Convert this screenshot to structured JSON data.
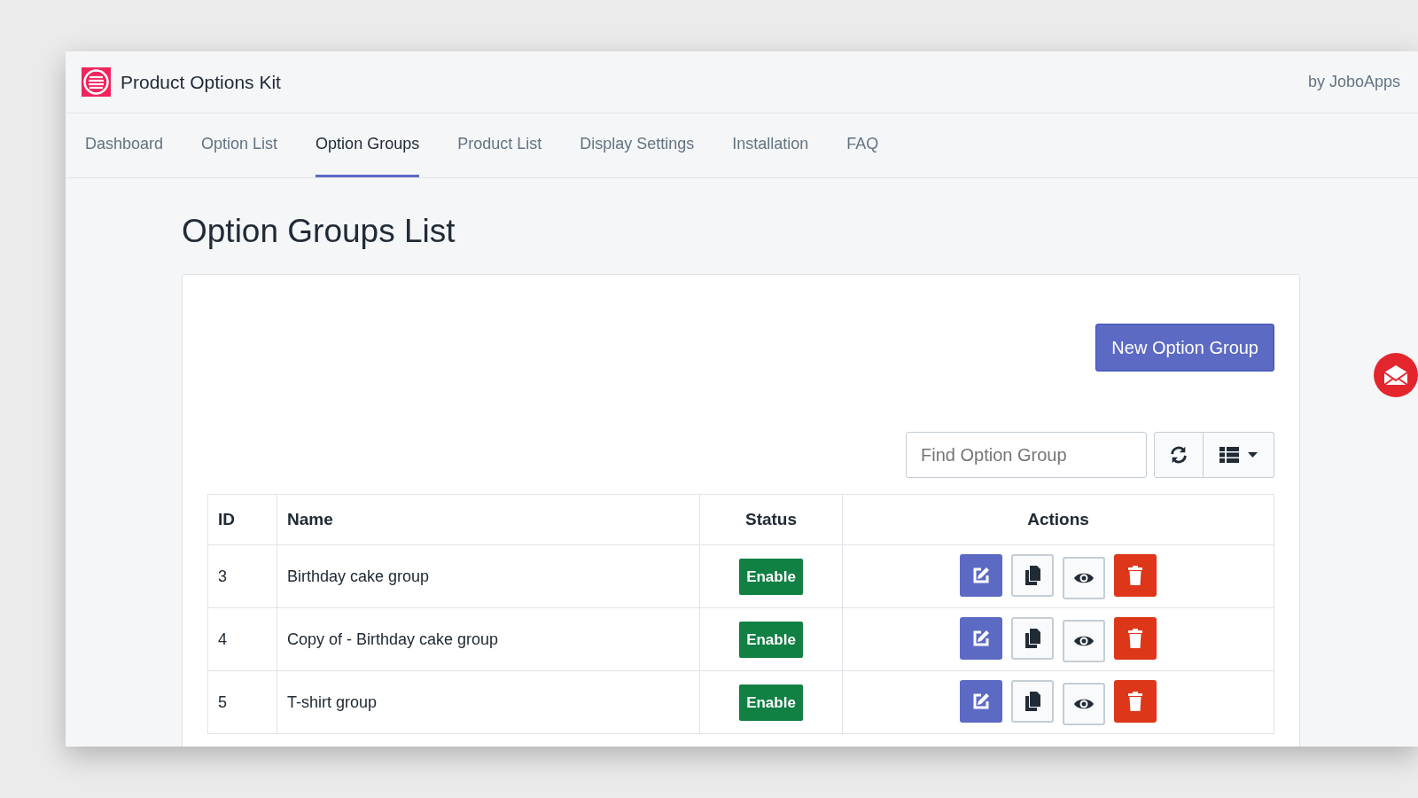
{
  "app": {
    "title": "Product Options Kit",
    "vendor": "by JoboApps"
  },
  "tabs": [
    {
      "label": "Dashboard",
      "selected": false
    },
    {
      "label": "Option List",
      "selected": false
    },
    {
      "label": "Option Groups",
      "selected": true
    },
    {
      "label": "Product List",
      "selected": false
    },
    {
      "label": "Display Settings",
      "selected": false
    },
    {
      "label": "Installation",
      "selected": false
    },
    {
      "label": "FAQ",
      "selected": false
    }
  ],
  "page_title": "Option Groups List",
  "new_button": "New Option Group",
  "search": {
    "placeholder": "Find Option Group"
  },
  "table": {
    "columns": [
      "ID",
      "Name",
      "Status",
      "Actions"
    ],
    "rows": [
      {
        "id": "3",
        "name": "Birthday cake group",
        "status": "Enable"
      },
      {
        "id": "4",
        "name": "Copy of - Birthday cake group",
        "status": "Enable"
      },
      {
        "id": "5",
        "name": "T-shirt group",
        "status": "Enable"
      }
    ]
  }
}
